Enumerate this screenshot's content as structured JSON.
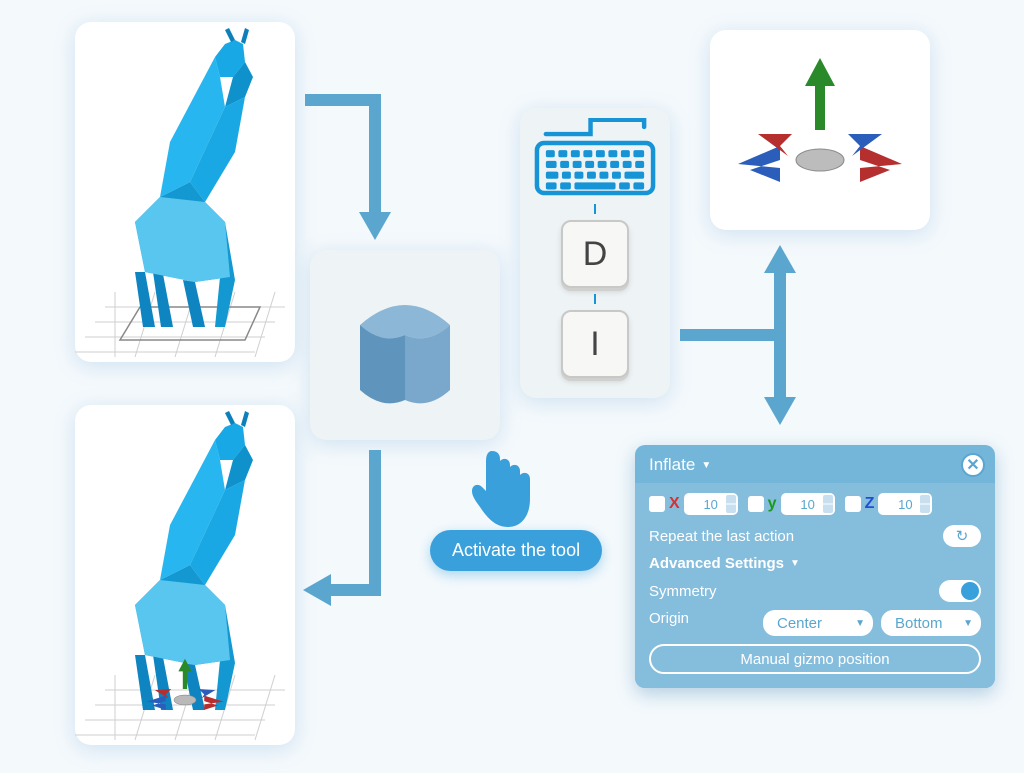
{
  "shortcut": {
    "key1": "D",
    "key2": "I"
  },
  "activate": {
    "label": "Activate the tool"
  },
  "panel": {
    "title": "Inflate",
    "x_label": "X",
    "y_label": "y",
    "z_label": "Z",
    "x_val": "10",
    "y_val": "10",
    "z_val": "10",
    "repeat_label": "Repeat the last action",
    "adv_label": "Advanced Settings",
    "symmetry_label": "Symmetry",
    "origin_label": "Origin",
    "origin_sel1": "Center",
    "origin_sel2": "Bottom",
    "manual_label": "Manual gizmo position"
  },
  "colors": {
    "primary": "#3aa0dc",
    "panel": "#74b5da"
  }
}
